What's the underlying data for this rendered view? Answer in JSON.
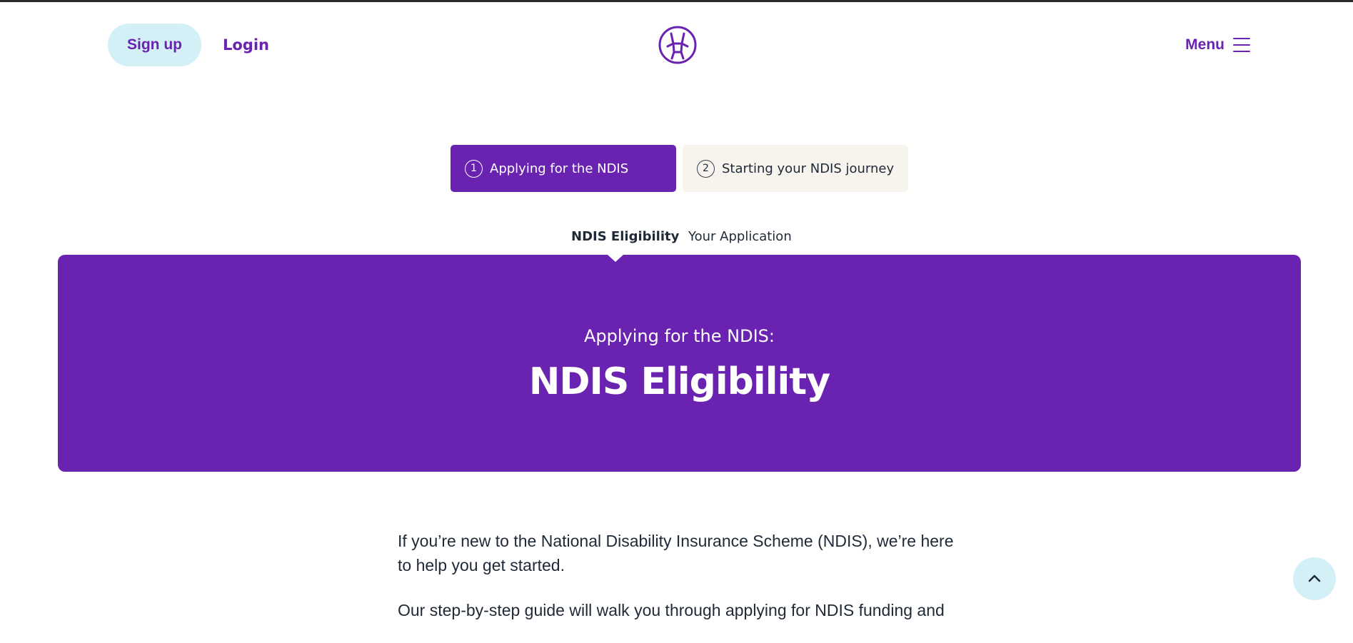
{
  "header": {
    "signup_label": "Sign up",
    "login_label": "Login",
    "logo_icon": "brand-logo-icon",
    "menu_label": "Menu",
    "menu_icon": "hamburger-icon"
  },
  "steps": [
    {
      "number": "1",
      "label": "Applying for the NDIS",
      "active": true
    },
    {
      "number": "2",
      "label": "Starting your NDIS journey",
      "active": false
    }
  ],
  "subtabs": [
    {
      "label": "NDIS Eligibility",
      "active": true
    },
    {
      "label": "Your Application",
      "active": false
    }
  ],
  "hero": {
    "kicker": "Applying for the NDIS:",
    "title": "NDIS Eligibility"
  },
  "content": {
    "paragraphs": [
      "If you’re new to the National Disability Insurance Scheme (NDIS), we’re here to help you get started.",
      "Our step-by-step guide will walk you through applying for NDIS funding and"
    ]
  },
  "back_to_top_icon": "chevron-up-icon",
  "colors": {
    "brand_purple": "#6a22b0",
    "accent_light_blue": "#d3f0f7",
    "inactive_tab_bg": "#f7f3ed"
  }
}
